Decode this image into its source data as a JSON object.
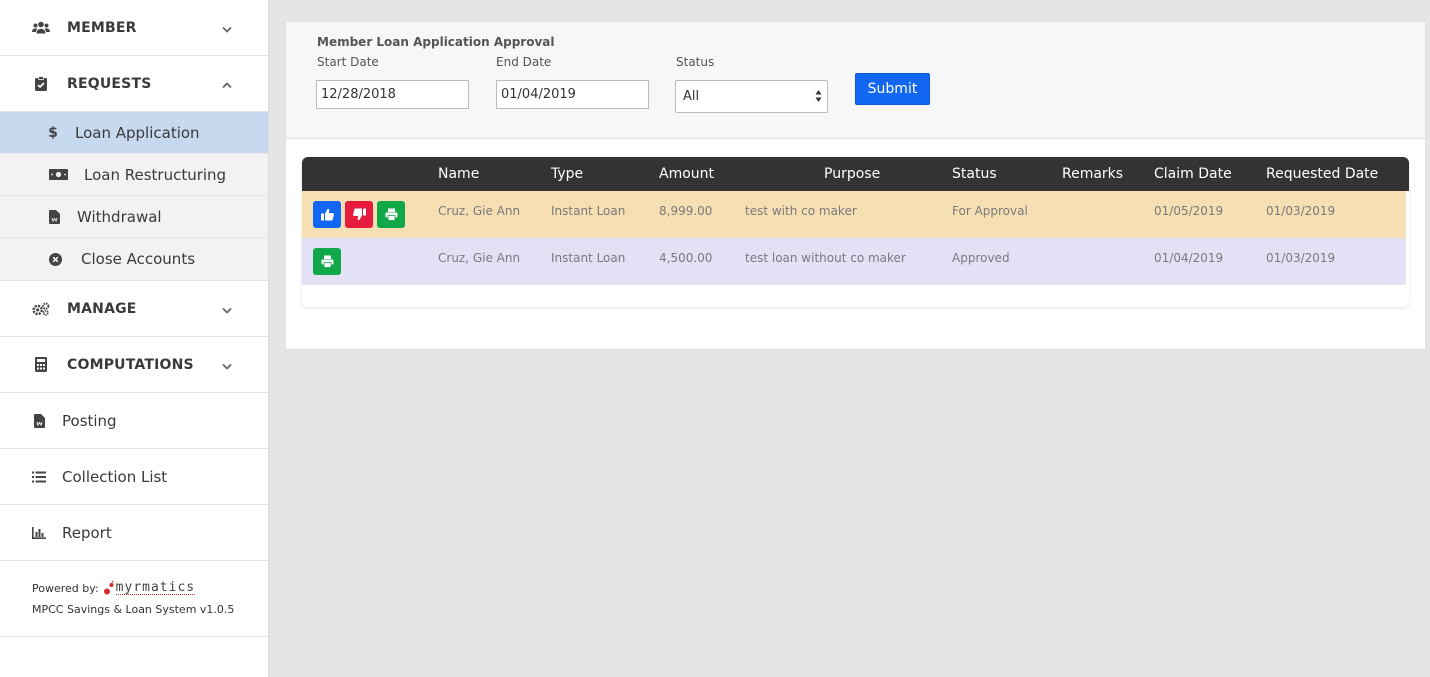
{
  "sidebar": {
    "member": "MEMBER",
    "requests": "REQUESTS",
    "requests_items": [
      "Loan Application",
      "Loan Restructuring",
      "Withdrawal",
      "Close Accounts"
    ],
    "manage": "MANAGE",
    "computations": "COMPUTATIONS",
    "posting": "Posting",
    "collection_list": "Collection List",
    "report": "Report",
    "powered_by": "Powered by:",
    "logo_text": "myrmatics",
    "version": "MPCC Savings & Loan System v1.0.5"
  },
  "form": {
    "title": "Member Loan Application Approval",
    "start_label": "Start Date",
    "start_value": "12/28/2018",
    "end_label": "End Date",
    "end_value": "01/04/2019",
    "status_label": "Status",
    "status_value": "All",
    "submit": "Submit"
  },
  "table": {
    "headers": [
      "Name",
      "Type",
      "Amount",
      "Purpose",
      "Status",
      "Remarks",
      "Claim Date",
      "Requested Date"
    ],
    "rows": [
      {
        "name": "Cruz, Gie Ann",
        "type": "Instant Loan",
        "amount": "8,999.00",
        "purpose": "test with co maker",
        "status": "For Approval",
        "remarks": "",
        "claim_date": "01/05/2019",
        "requested_date": "01/03/2019"
      },
      {
        "name": "Cruz, Gie Ann",
        "type": "Instant Loan",
        "amount": "4,500.00",
        "purpose": "test loan without co maker",
        "status": "Approved",
        "remarks": "",
        "claim_date": "01/04/2019",
        "requested_date": "01/03/2019"
      }
    ]
  },
  "colors": {
    "accent": "#1167f2",
    "reject": "#e51c3d",
    "print": "#11a84a",
    "row_pending": "#f5dfb3",
    "row_approved": "#e3e1f5",
    "active_nav": "#c7d9ef"
  }
}
